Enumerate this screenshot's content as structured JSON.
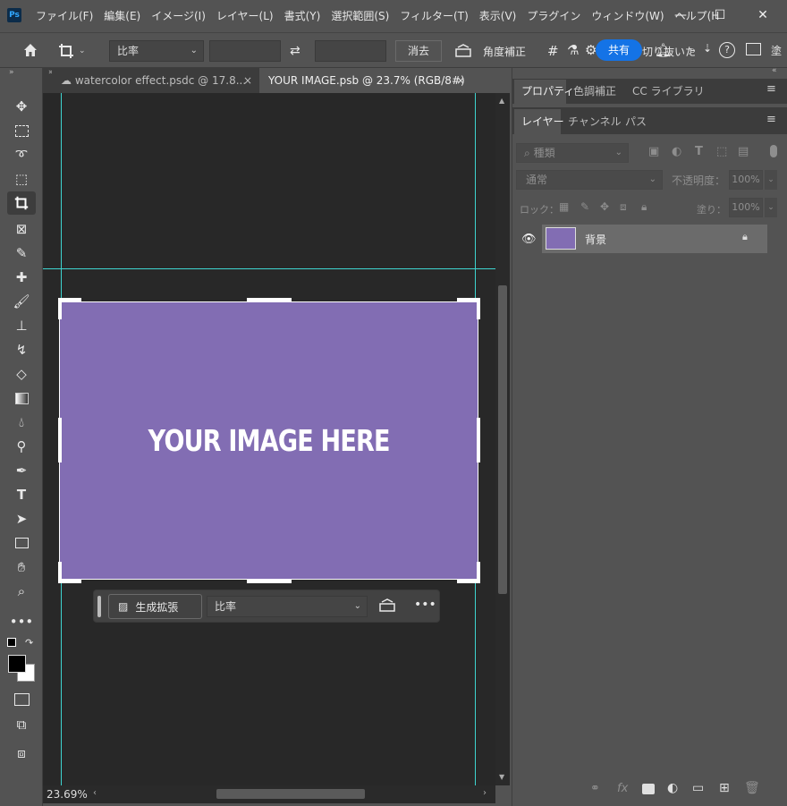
{
  "app": {
    "logo": "Ps"
  },
  "menu": [
    "ファイル(F)",
    "編集(E)",
    "イメージ(I)",
    "レイヤー(L)",
    "書式(Y)",
    "選択範囲(S)",
    "フィルター(T)",
    "表示(V)",
    "プラグイン",
    "ウィンドウ(W)",
    "ヘルプ(H"
  ],
  "options": {
    "ratio_label": "比率",
    "clear_label": "消去",
    "straighten_label": "角度補正",
    "share_label": "共有",
    "fill_label_partial": "塗",
    "remove_partial": "切り抜いた"
  },
  "tabs": [
    {
      "label": "watercolor effect.psdc @ 17.8...",
      "active": false
    },
    {
      "label": "YOUR IMAGE.psb @ 23.7% (RGB/8#)",
      "active": true
    }
  ],
  "canvas": {
    "image_text": "YOUR IMAGE HERE",
    "image_color": "#826db3",
    "zoom": "23.69%"
  },
  "context_bar": {
    "generate_label": "生成拡張",
    "ratio_label": "比率"
  },
  "panel": {
    "top_tabs": [
      "プロパティ",
      "色調補正",
      "CC ライブラリ"
    ],
    "layer_tabs": [
      "レイヤー",
      "チャンネル",
      "パス"
    ],
    "search_placeholder": "種類",
    "blend_mode": "通常",
    "opacity_label": "不透明度：",
    "opacity_value": "100%",
    "lock_label": "ロック：",
    "fill_label": "塗り：",
    "fill_value": "100%",
    "layer_name": "背景"
  },
  "colors": {
    "accent": "#1473e6",
    "guide": "#3ed4d0"
  }
}
